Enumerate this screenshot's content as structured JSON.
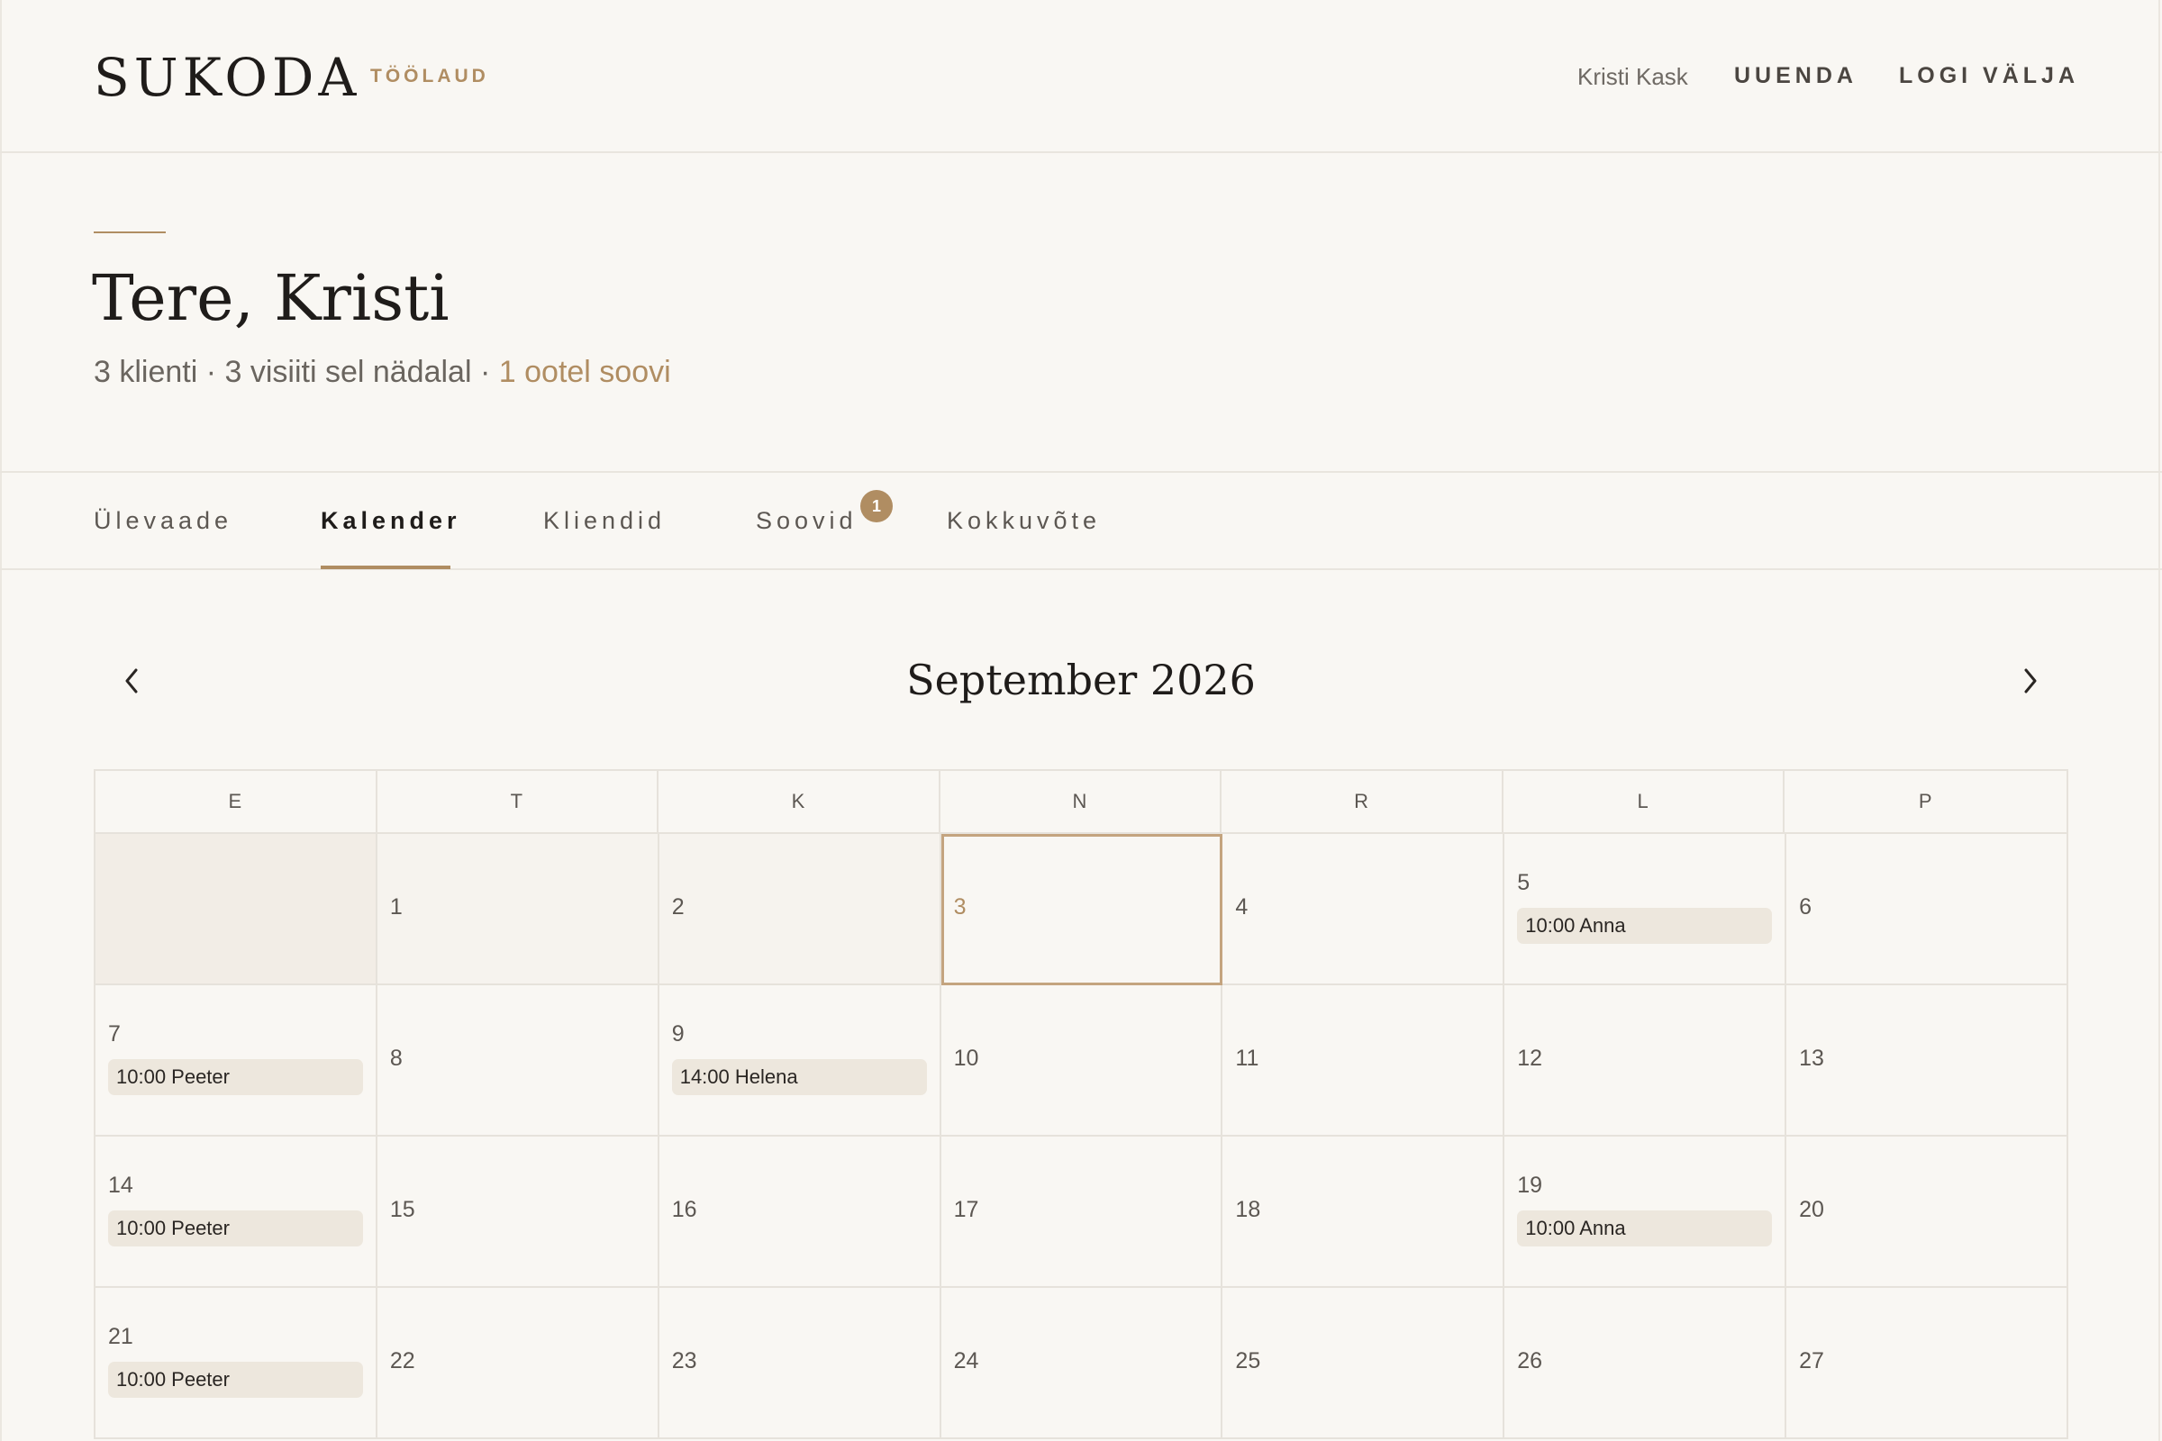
{
  "header": {
    "logo": "SUKODA",
    "logo_sub": "TÖÖLAUD",
    "user_name": "Kristi Kask",
    "refresh_label": "UUENDA",
    "logout_label": "LOGI VÄLJA"
  },
  "greeting": {
    "title": "Tere, Kristi",
    "summary_stats": "3 klienti · 3 visiiti sel nädalal",
    "summary_separator": "·",
    "summary_pending": "1 ootel soovi"
  },
  "tabs": [
    {
      "label": "Ülevaade"
    },
    {
      "label": "Kalender",
      "active": true
    },
    {
      "label": "Kliendid"
    },
    {
      "label": "Soovid",
      "badge": "1"
    },
    {
      "label": "Kokkuvõte"
    }
  ],
  "calendar": {
    "month_title": "September 2026",
    "prev_icon": "chevron-left-icon",
    "next_icon": "chevron-right-icon",
    "weekdays": [
      "E",
      "T",
      "K",
      "N",
      "R",
      "L",
      "P"
    ],
    "weeks": [
      [
        {
          "day": null,
          "state": "empty"
        },
        {
          "day": "1",
          "state": "past"
        },
        {
          "day": "2",
          "state": "past"
        },
        {
          "day": "3",
          "state": "today"
        },
        {
          "day": "4"
        },
        {
          "day": "5",
          "event": "10:00 Anna"
        },
        {
          "day": "6"
        }
      ],
      [
        {
          "day": "7",
          "event": "10:00 Peeter"
        },
        {
          "day": "8"
        },
        {
          "day": "9",
          "event": "14:00 Helena"
        },
        {
          "day": "10"
        },
        {
          "day": "11"
        },
        {
          "day": "12"
        },
        {
          "day": "13"
        }
      ],
      [
        {
          "day": "14",
          "event": "10:00 Peeter"
        },
        {
          "day": "15"
        },
        {
          "day": "16"
        },
        {
          "day": "17"
        },
        {
          "day": "18"
        },
        {
          "day": "19",
          "event": "10:00 Anna"
        },
        {
          "day": "20"
        }
      ],
      [
        {
          "day": "21",
          "event": "10:00 Peeter"
        },
        {
          "day": "22"
        },
        {
          "day": "23"
        },
        {
          "day": "24"
        },
        {
          "day": "25"
        },
        {
          "day": "26"
        },
        {
          "day": "27"
        }
      ]
    ]
  },
  "colors": {
    "accent": "#b08d62",
    "background": "#f9f7f3",
    "event_bg": "#ede7dd"
  }
}
